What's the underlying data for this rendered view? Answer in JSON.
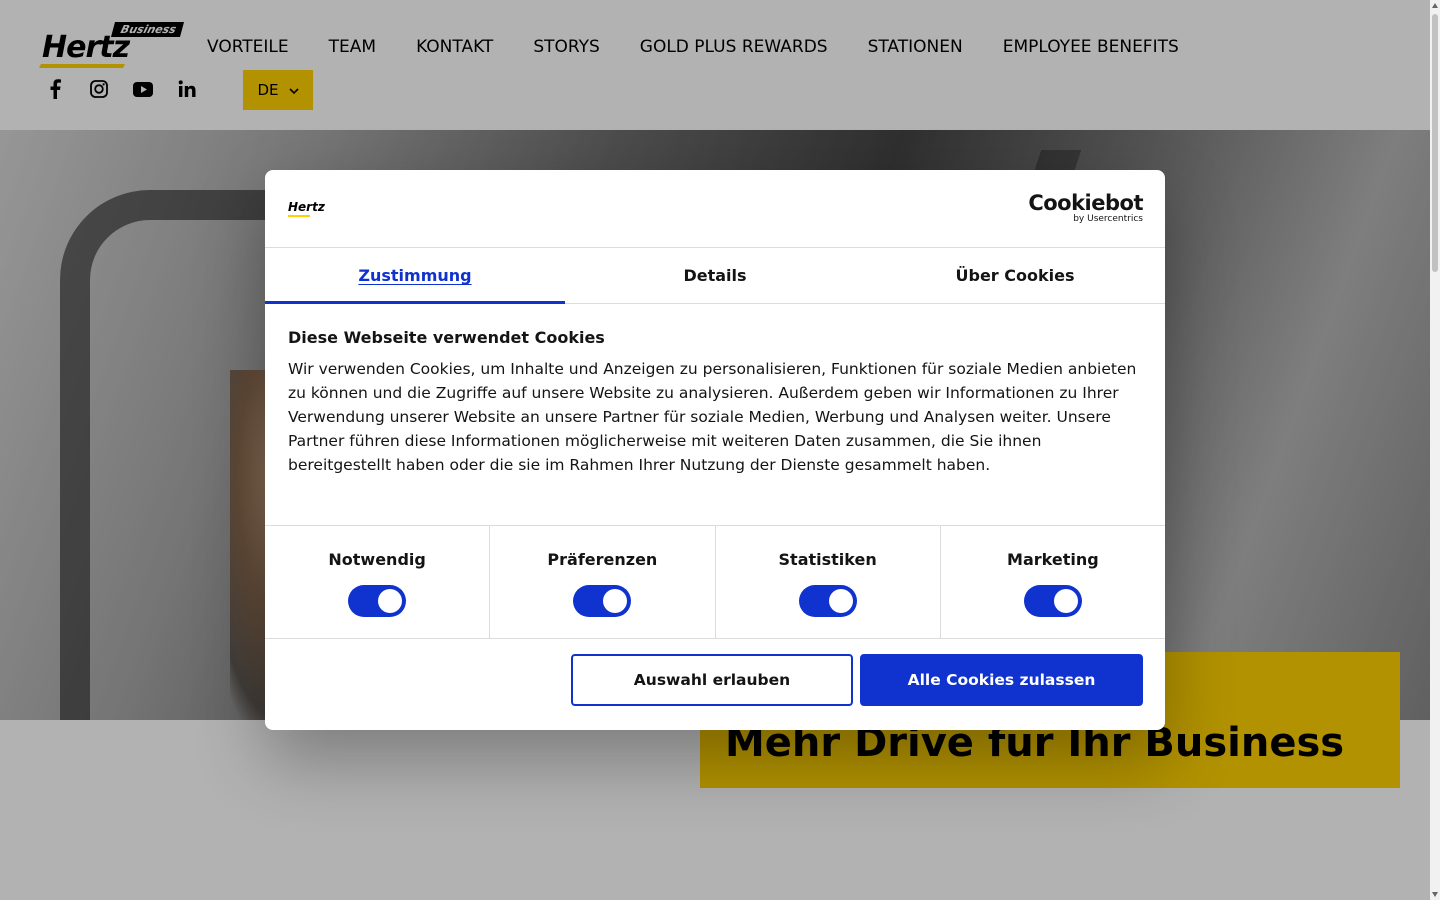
{
  "site": {
    "logo": {
      "wordmark": "Hertz",
      "tag": "Business"
    },
    "nav": [
      {
        "label": "VORTEILE"
      },
      {
        "label": "TEAM"
      },
      {
        "label": "KONTAKT"
      },
      {
        "label": "STORYS"
      },
      {
        "label": "GOLD PLUS REWARDS"
      },
      {
        "label": "STATIONEN"
      },
      {
        "label": "EMPLOYEE BENEFITS"
      }
    ],
    "social_icons": [
      "facebook-icon",
      "instagram-icon",
      "youtube-icon",
      "linkedin-icon"
    ],
    "language": {
      "value": "DE"
    },
    "promo_title": "Mehr Drive für Ihr Business",
    "brand_color": "#ffd100"
  },
  "cookie_dialog": {
    "brand_logo": "Hertz",
    "provider": {
      "name": "Cookiebot",
      "sub": "by Usercentrics"
    },
    "tabs": [
      {
        "label": "Zustimmung",
        "active": true
      },
      {
        "label": "Details",
        "active": false
      },
      {
        "label": "Über Cookies",
        "active": false
      }
    ],
    "heading": "Diese Webseite verwendet Cookies",
    "body": "Wir verwenden Cookies, um Inhalte und Anzeigen zu personalisieren, Funktionen für soziale Medien anbieten zu können und die Zugriffe auf unsere Website zu analysieren. Außerdem geben wir Informationen zu Ihrer Verwendung unserer Website an unsere Partner für soziale Medien, Werbung und Analysen weiter. Unsere Partner führen diese Informationen möglicherweise mit weiteren Daten zusammen, die Sie ihnen bereitgestellt haben oder die sie im Rahmen Ihrer Nutzung der Dienste gesammelt haben.",
    "toggles": [
      {
        "label": "Notwendig",
        "on": true
      },
      {
        "label": "Präferenzen",
        "on": true
      },
      {
        "label": "Statistiken",
        "on": true
      },
      {
        "label": "Marketing",
        "on": true
      }
    ],
    "buttons": {
      "allow_selection": "Auswahl erlauben",
      "allow_all": "Alle Cookies zulassen"
    },
    "accent_color": "#1032cf"
  }
}
